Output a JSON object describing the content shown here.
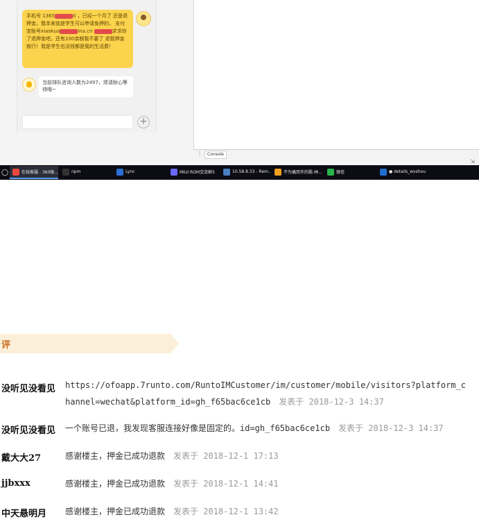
{
  "chat": {
    "user_message": {
      "pre": "手机号 1365",
      "mid": "0 ，已经一个月了 还是退押金，我本来就是学生可以申请免押的， 支付宝账号xiaokua",
      "mid2": "ina.cn",
      "post": "求求你了退押金吧，还有100余额我不要了 退我押金就行！我是学生也没钱都是我的生活费！"
    },
    "bot_message": "当前排队咨询人数为2497，烦请耐心等待哦~"
  },
  "devtools": {
    "console_tab": "Console"
  },
  "taskbar": {
    "items": [
      {
        "label": "在线客服 - 360极...",
        "color": "#e94a3c",
        "active": true
      },
      {
        "label": "npm",
        "color": "#333333",
        "active": false
      },
      {
        "label": "Lync",
        "color": "#2a6fd6",
        "active": false
      },
      {
        "label": "MIUI ROM交流群5",
        "color": "#6a6aff",
        "active": false
      },
      {
        "label": "10.58.8.33 - Rem...",
        "color": "#4a7fc0",
        "active": false
      },
      {
        "label": "不为痛而作的歌-林...",
        "color": "#f0a020",
        "active": false
      },
      {
        "label": "微信",
        "color": "#2ab34a",
        "active": false
      },
      {
        "label": "● details_wxshouf...",
        "color": "#1f6fd0",
        "active": false
      }
    ]
  },
  "section": {
    "tag": "评"
  },
  "comments": [
    {
      "author": "没听见没看见",
      "text": "https://ofoapp.7runto.com/RuntoIMCustomer/im/customer/mobile/visitors?platform_channel=wechat&platform_id=gh_f65bac6ce1cb",
      "meta": "发表于 2018-12-3 14:37"
    },
    {
      "author": "没听见没看见",
      "text": "一个账号已退，我发现客服连接好像是固定的。id=gh_f65bac6ce1cb",
      "meta": "发表于 2018-12-3 14:37"
    },
    {
      "author": "戴大大27",
      "text": "感谢楼主，押金已成功退款",
      "meta": "发表于 2018-12-1 17:13"
    },
    {
      "author": "jjbxxx",
      "text": "感谢楼主，押金已成功退款",
      "meta": "发表于 2018-12-1 14:41"
    },
    {
      "author": "中天悬明月",
      "text": "感谢楼主，押金已成功退款",
      "meta": "发表于 2018-12-1 13:42"
    }
  ]
}
